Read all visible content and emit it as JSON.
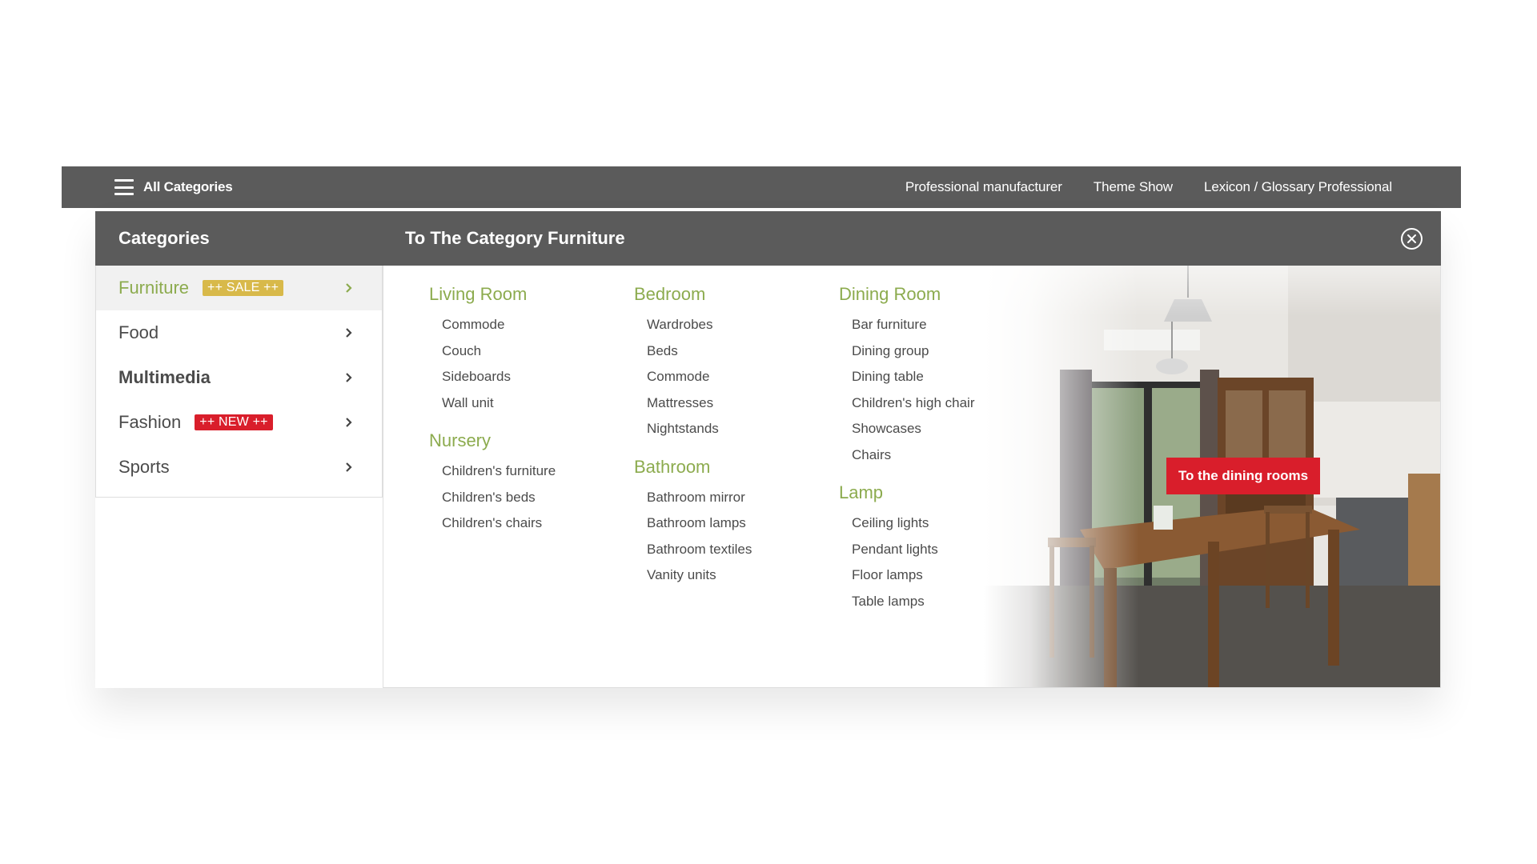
{
  "topbar": {
    "all_categories": "All Categories",
    "links": [
      "Professional manufacturer",
      "Theme Show",
      "Lexicon / Glossary Professional"
    ]
  },
  "menu": {
    "sidebar_title": "Categories",
    "content_title": "To The Category Furniture",
    "categories": [
      {
        "label": "Furniture",
        "badge": "++ SALE ++"
      },
      {
        "label": "Food",
        "badge": ""
      },
      {
        "label": "Multimedia",
        "badge": ""
      },
      {
        "label": "Fashion",
        "badge": "++ NEW ++"
      },
      {
        "label": "Sports",
        "badge": ""
      }
    ],
    "groups": {
      "living_room": {
        "title": "Living Room",
        "items": [
          "Commode",
          "Couch",
          "Sideboards",
          "Wall unit"
        ]
      },
      "nursery": {
        "title": "Nursery",
        "items": [
          "Children's furniture",
          "Children's beds",
          "Children's chairs"
        ]
      },
      "bedroom": {
        "title": "Bedroom",
        "items": [
          "Wardrobes",
          "Beds",
          "Commode",
          "Mattresses",
          "Nightstands"
        ]
      },
      "bathroom": {
        "title": "Bathroom",
        "items": [
          "Bathroom mirror",
          "Bathroom lamps",
          "Bathroom textiles",
          "Vanity units"
        ]
      },
      "dining_room": {
        "title": "Dining Room",
        "items": [
          "Bar furniture",
          "Dining group",
          "Dining table",
          "Children's high chair",
          "Showcases",
          "Chairs"
        ]
      },
      "lamp": {
        "title": "Lamp",
        "items": [
          "Ceiling lights",
          "Pendant lights",
          "Floor lamps",
          "Table lamps"
        ]
      }
    },
    "cta_label": "To the dining rooms"
  },
  "colors": {
    "bar": "#5b5b5b",
    "accent_green": "#8cab4e",
    "sale_badge": "#d8b94a",
    "new_badge": "#d91e2b",
    "cta": "#d91e2b"
  },
  "icons": [
    "hamburger-icon",
    "close-icon",
    "chevron-right-icon"
  ]
}
